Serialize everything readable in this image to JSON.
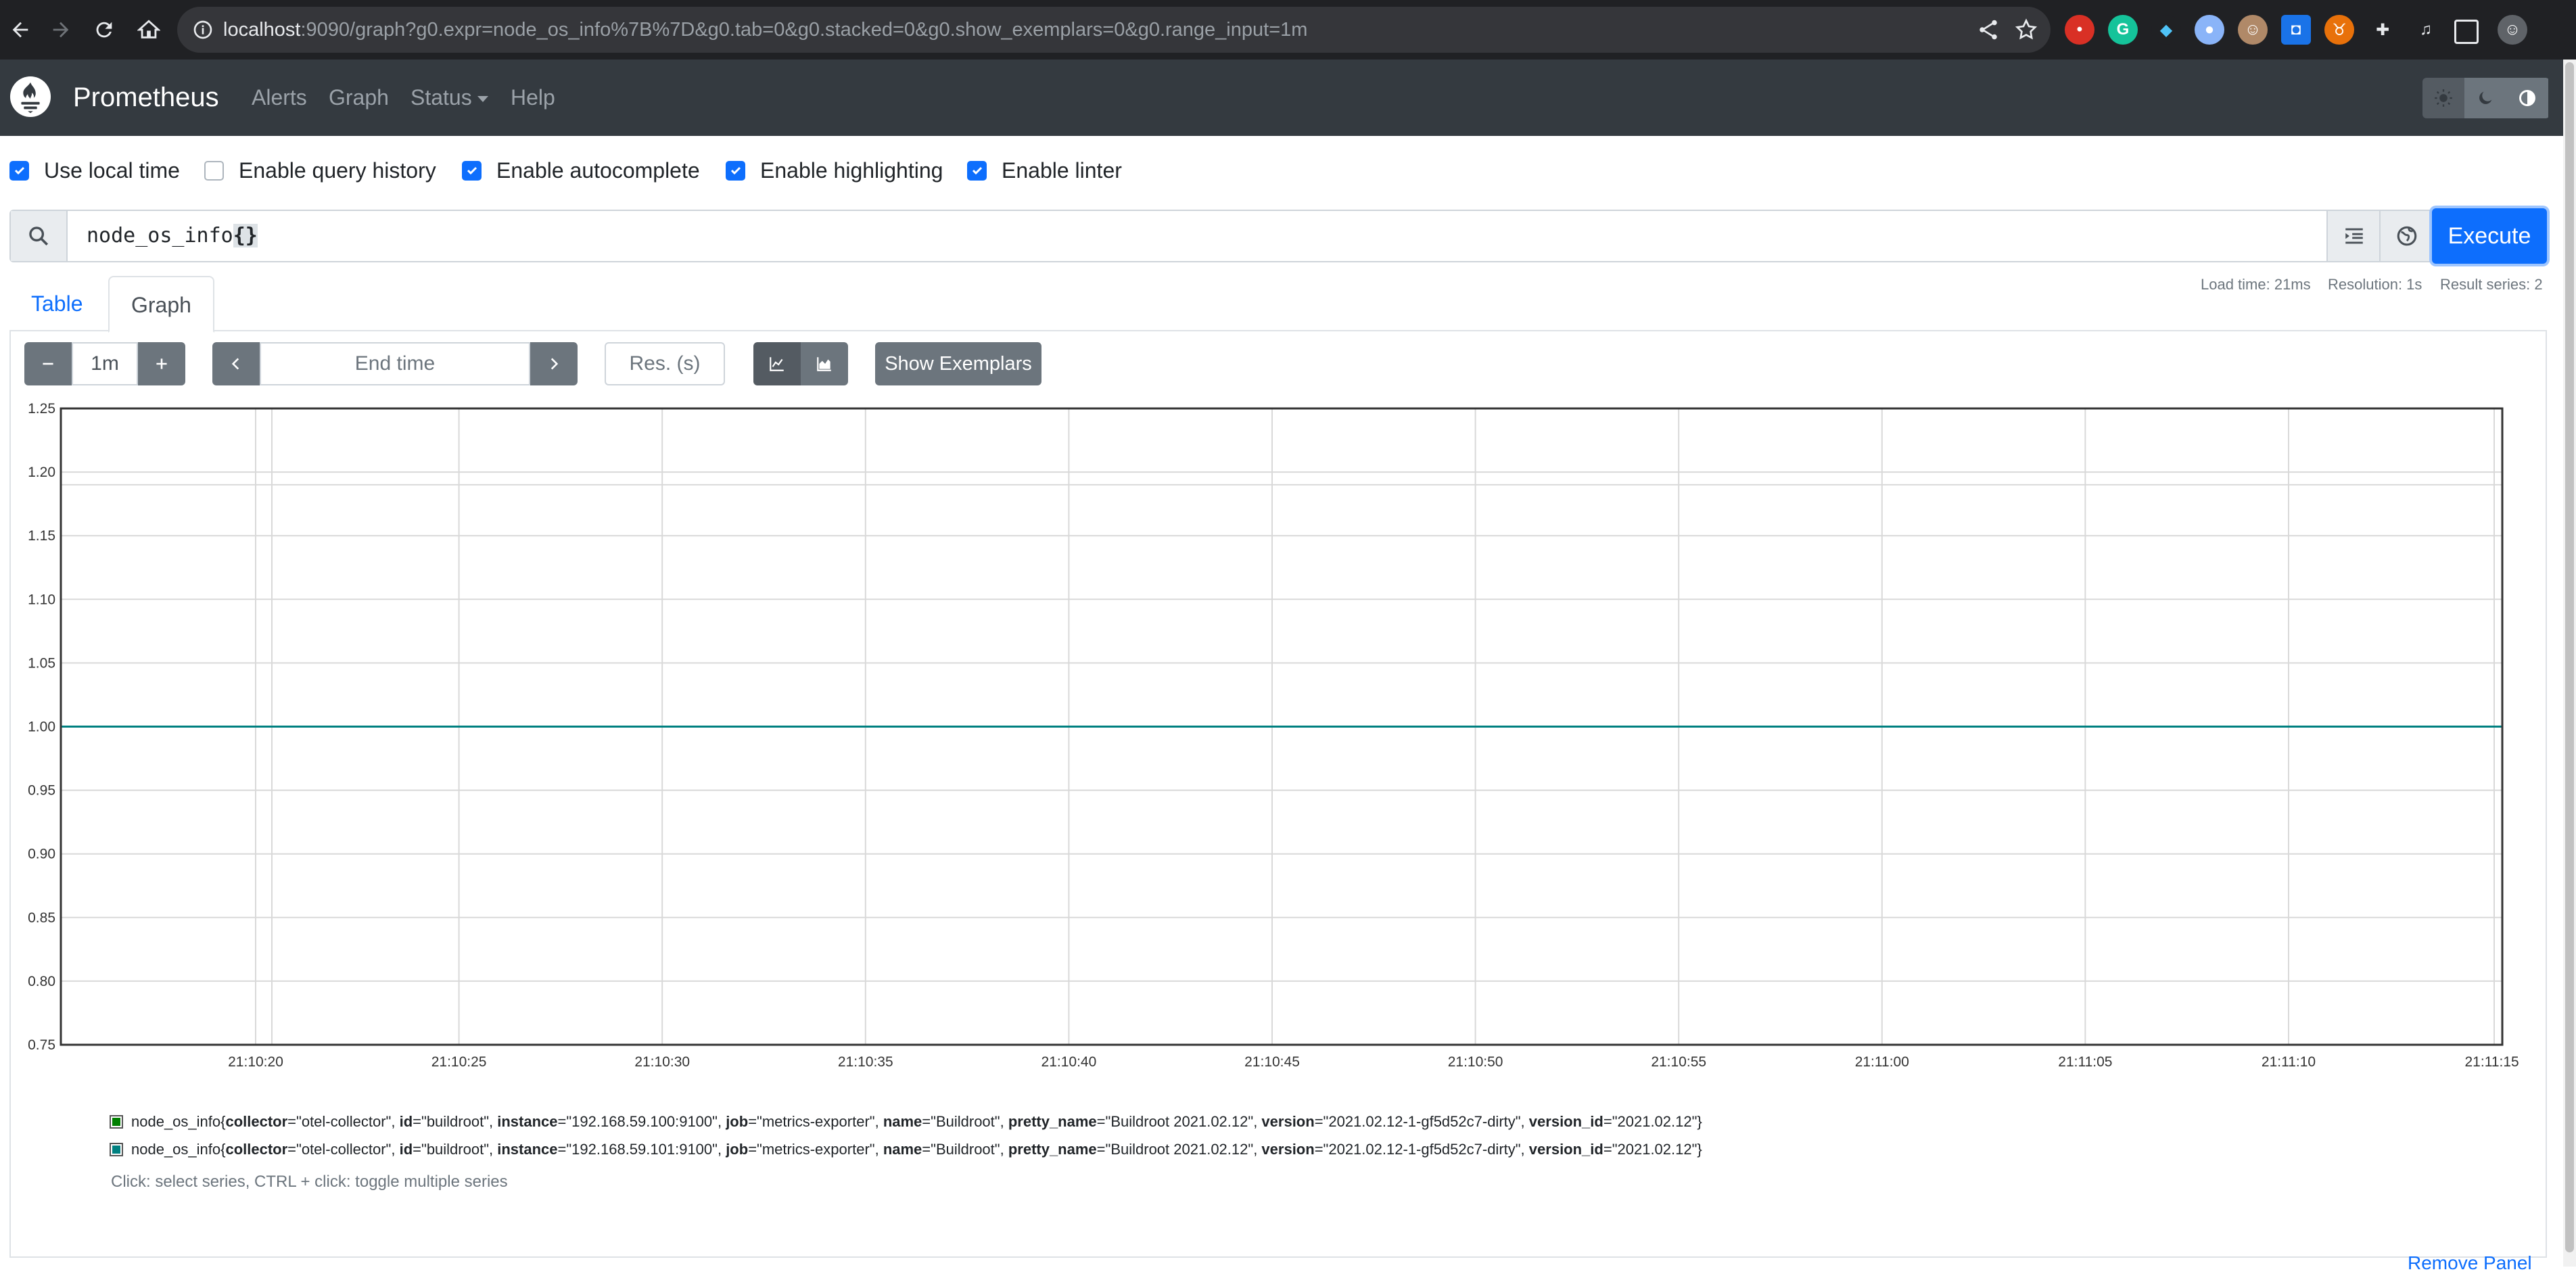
{
  "browser": {
    "url_host": "localhost",
    "url_rest": ":9090/graph?g0.expr=node_os_info%7B%7D&g0.tab=0&g0.stacked=0&g0.show_exemplars=0&g0.range_input=1m",
    "extensions": [
      "shield-ext",
      "grammarly-ext",
      "gem-ext",
      "circle-ext",
      "avatar-ext",
      "badge-ext",
      "bull-ext",
      "puzzle-ext",
      "media-ext",
      "sidepanel-ext",
      "profile-ext"
    ]
  },
  "navbar": {
    "brand": "Prometheus",
    "links": [
      "Alerts",
      "Graph",
      "Status",
      "Help"
    ]
  },
  "options": [
    {
      "label": "Use local time",
      "checked": true
    },
    {
      "label": "Enable query history",
      "checked": false
    },
    {
      "label": "Enable autocomplete",
      "checked": true
    },
    {
      "label": "Enable highlighting",
      "checked": true
    },
    {
      "label": "Enable linter",
      "checked": true
    }
  ],
  "query": {
    "metric": "node_os_info",
    "braces": "{}",
    "execute_label": "Execute"
  },
  "tabs": {
    "table": "Table",
    "graph": "Graph"
  },
  "stats": {
    "load_time": "Load time: 21ms",
    "resolution": "Resolution: 1s",
    "result_series": "Result series: 2"
  },
  "controls": {
    "range": "1m",
    "end_time_placeholder": "End time",
    "resolution_placeholder": "Res. (s)",
    "show_exemplars": "Show Exemplars"
  },
  "chart_data": {
    "type": "line",
    "y_ticks": [
      "1.25",
      "1.20",
      "1.15",
      "1.10",
      "1.05",
      "1.00",
      "0.95",
      "0.90",
      "0.85",
      "0.80",
      "0.75"
    ],
    "x_ticks": [
      "21:10:20",
      "21:10:25",
      "21:10:30",
      "21:10:35",
      "21:10:40",
      "21:10:45",
      "21:10:50",
      "21:10:55",
      "21:11:00",
      "21:11:05",
      "21:11:10",
      "21:11:15"
    ],
    "ylim": [
      0.75,
      1.25
    ],
    "series": [
      {
        "name": "node_os_info{collector=\"otel-collector\", id=\"buildroot\", instance=\"192.168.59.100:9100\", job=\"metrics-exporter\", name=\"Buildroot\", pretty_name=\"Buildroot 2021.02.12\", version=\"2021.02.12-1-gf5d52c7-dirty\", version_id=\"2021.02.12\"}",
        "value": 1,
        "color": "#008000"
      },
      {
        "name": "node_os_info{collector=\"otel-collector\", id=\"buildroot\", instance=\"192.168.59.101:9100\", job=\"metrics-exporter\", name=\"Buildroot\", pretty_name=\"Buildroot 2021.02.12\", version=\"2021.02.12-1-gf5d52c7-dirty\", version_id=\"2021.02.12\"}",
        "value": 1,
        "color": "#008080"
      }
    ],
    "grid": true
  },
  "legend": [
    {
      "color": "#008000",
      "parts": [
        {
          "t": "node_os_info{",
          "k": false
        },
        {
          "t": "collector",
          "k": true
        },
        {
          "t": "=\"otel-collector\", ",
          "k": false
        },
        {
          "t": "id",
          "k": true
        },
        {
          "t": "=\"buildroot\", ",
          "k": false
        },
        {
          "t": "instance",
          "k": true
        },
        {
          "t": "=\"192.168.59.100:9100\", ",
          "k": false
        },
        {
          "t": "job",
          "k": true
        },
        {
          "t": "=\"metrics-exporter\", ",
          "k": false
        },
        {
          "t": "name",
          "k": true
        },
        {
          "t": "=\"Buildroot\", ",
          "k": false
        },
        {
          "t": "pretty_name",
          "k": true
        },
        {
          "t": "=\"Buildroot 2021.02.12\", ",
          "k": false
        },
        {
          "t": "version",
          "k": true
        },
        {
          "t": "=\"2021.02.12-1-gf5d52c7-dirty\", ",
          "k": false
        },
        {
          "t": "version_id",
          "k": true
        },
        {
          "t": "=\"2021.02.12\"}",
          "k": false
        }
      ]
    },
    {
      "color": "#008080",
      "parts": [
        {
          "t": "node_os_info{",
          "k": false
        },
        {
          "t": "collector",
          "k": true
        },
        {
          "t": "=\"otel-collector\", ",
          "k": false
        },
        {
          "t": "id",
          "k": true
        },
        {
          "t": "=\"buildroot\", ",
          "k": false
        },
        {
          "t": "instance",
          "k": true
        },
        {
          "t": "=\"192.168.59.101:9100\", ",
          "k": false
        },
        {
          "t": "job",
          "k": true
        },
        {
          "t": "=\"metrics-exporter\", ",
          "k": false
        },
        {
          "t": "name",
          "k": true
        },
        {
          "t": "=\"Buildroot\", ",
          "k": false
        },
        {
          "t": "pretty_name",
          "k": true
        },
        {
          "t": "=\"Buildroot 2021.02.12\", ",
          "k": false
        },
        {
          "t": "version",
          "k": true
        },
        {
          "t": "=\"2021.02.12-1-gf5d52c7-dirty\", ",
          "k": false
        },
        {
          "t": "version_id",
          "k": true
        },
        {
          "t": "=\"2021.02.12\"}",
          "k": false
        }
      ]
    }
  ],
  "hint": "Click: select series, CTRL + click: toggle multiple series",
  "remove_panel": "Remove Panel"
}
